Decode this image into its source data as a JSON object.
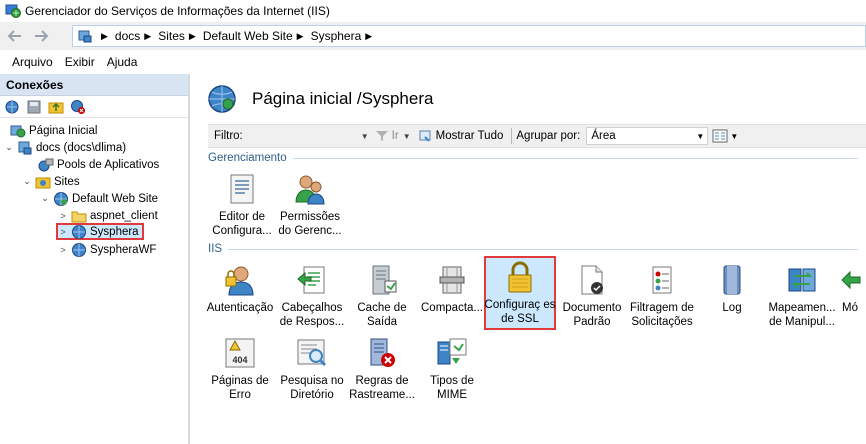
{
  "window": {
    "title": "Gerenciador do Serviços de Informações da Internet (IIS)"
  },
  "address": {
    "crumbs": [
      "docs",
      "Sites",
      "Default Web Site",
      "Sysphera"
    ]
  },
  "menu": {
    "items": [
      "Arquivo",
      "Exibir",
      "Ajuda"
    ]
  },
  "connections": {
    "header": "Conexões",
    "tree": [
      {
        "label": "Página Inicial",
        "expander": ""
      },
      {
        "label": "docs (docs\\dlima)",
        "expander": "⌄"
      },
      {
        "label": "Pools de Aplicativos",
        "expander": ""
      },
      {
        "label": "Sites",
        "expander": "⌄"
      },
      {
        "label": "Default Web Site",
        "expander": "⌄"
      },
      {
        "label": "aspnet_client",
        "expander": ">"
      },
      {
        "label": "Sysphera",
        "expander": ">"
      },
      {
        "label": "SyspheraWF",
        "expander": ">"
      }
    ]
  },
  "main": {
    "title": "Página inicial /Sysphera",
    "filter": {
      "label": "Filtro:",
      "go": "Ir",
      "show_all": "Mostrar Tudo",
      "group_label": "Agrupar por:",
      "group_value": "Área"
    },
    "sections": [
      "Gerenciamento",
      "IIS"
    ],
    "management": [
      {
        "label": "Editor de Configura...",
        "icon": "config-editor-icon"
      },
      {
        "label": "Permissões do Gerenc...",
        "icon": "permissions-icon"
      }
    ],
    "iis": [
      {
        "label": "Autenticação",
        "icon": "authentication-icon"
      },
      {
        "label": "Cabeçalhos de Respos...",
        "icon": "response-headers-icon"
      },
      {
        "label": "Cache de Saída",
        "icon": "output-cache-icon"
      },
      {
        "label": "Compacta...",
        "icon": "compression-icon"
      },
      {
        "label": "Configuraç es de SSL",
        "icon": "ssl-lock-icon"
      },
      {
        "label": "Documento Padrão",
        "icon": "default-document-icon"
      },
      {
        "label": "Filtragem de Solicitações",
        "icon": "request-filtering-icon"
      },
      {
        "label": "Log",
        "icon": "log-icon"
      },
      {
        "label": "Mapeamen... de Manipul...",
        "icon": "handler-mappings-icon"
      },
      {
        "label": "Mó",
        "icon": "modules-icon"
      },
      {
        "label": "Páginas de Erro",
        "icon": "error-pages-icon"
      },
      {
        "label": "Pesquisa no Diretório",
        "icon": "directory-browsing-icon"
      },
      {
        "label": "Regras de Rastreame...",
        "icon": "failed-request-tracing-icon"
      },
      {
        "label": "Tipos de MIME",
        "icon": "mime-types-icon"
      }
    ],
    "error_icon_text": "404"
  },
  "colors": {
    "accent": "#2e5e8c",
    "selection": "#cce8ff",
    "highlight_border": "#e23a3a"
  }
}
